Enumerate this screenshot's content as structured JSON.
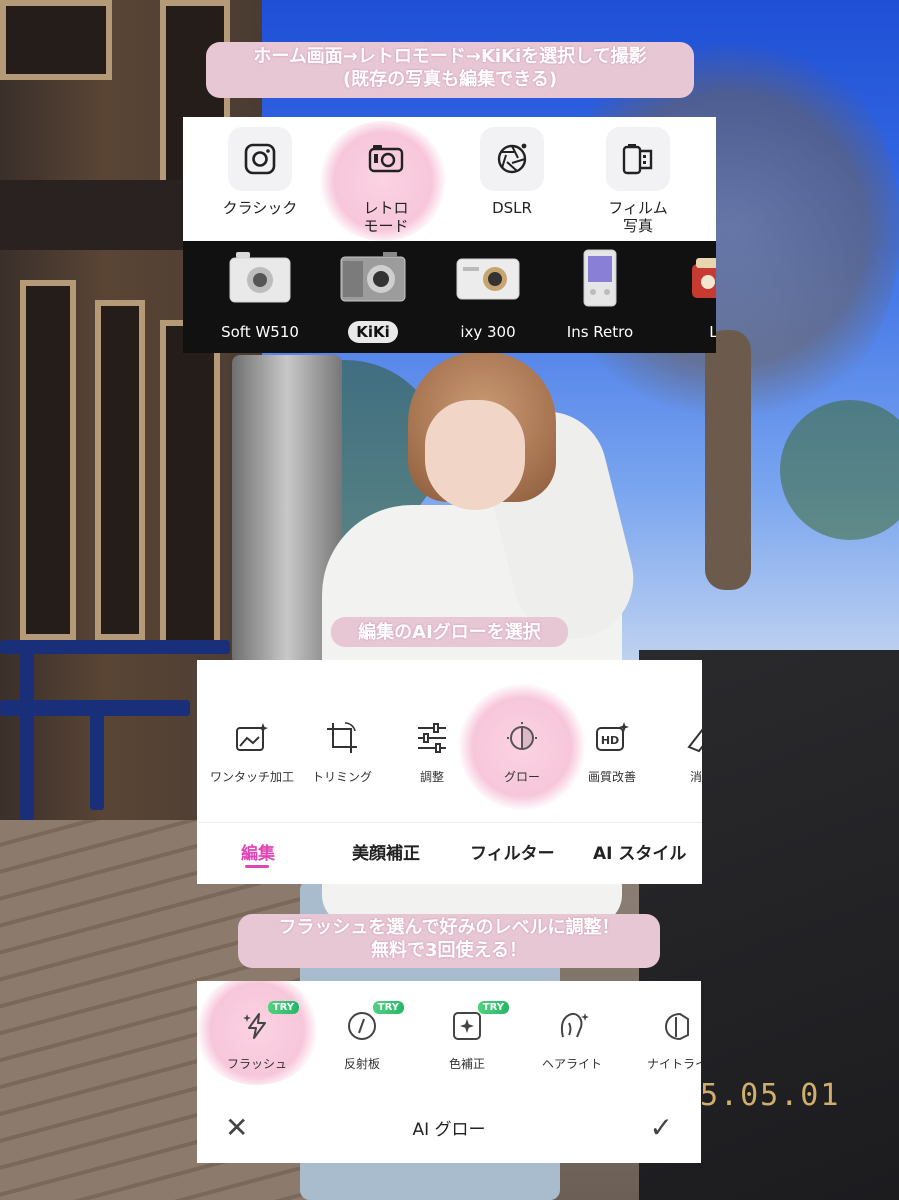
{
  "captions": {
    "top_line1": "ホーム画面→レトロモード→KiKiを選択して撮影",
    "top_line2": "(既存の写真も編集できる)",
    "middle": "編集のAIグローを選択",
    "bottom_line1": "フラッシュを選んで好みのレベルに調整！",
    "bottom_line2": "無料で3回使える！"
  },
  "mode_picker": {
    "modes": [
      {
        "label": "クラシック",
        "icon": "camera-icon"
      },
      {
        "label": "レトロ\nモード",
        "icon": "retro-camera-icon",
        "highlighted": true
      },
      {
        "label": "DSLR",
        "icon": "aperture-icon"
      },
      {
        "label": "フィルム\n写真",
        "icon": "film-icon"
      }
    ]
  },
  "camera_models": {
    "items": [
      {
        "label": "Soft W510",
        "icon": "compact-camera-silver-icon"
      },
      {
        "label": "KiKi",
        "icon": "compact-camera-gray-icon",
        "selected": true
      },
      {
        "label": "ixy 300",
        "icon": "compact-camera-white-icon"
      },
      {
        "label": "Ins Retro",
        "icon": "instant-camera-icon"
      },
      {
        "label": "Lu",
        "icon": "red-camera-icon"
      }
    ]
  },
  "edit_tools": {
    "tools": [
      {
        "label": "ワンタッチ加工",
        "icon": "magic-image-icon"
      },
      {
        "label": "トリミング",
        "icon": "crop-rotate-icon"
      },
      {
        "label": "調整",
        "icon": "sliders-icon"
      },
      {
        "label": "グロー",
        "icon": "glow-icon",
        "highlighted": true
      },
      {
        "label": "画質改善",
        "icon": "hd-icon"
      },
      {
        "label": "消し",
        "icon": "eraser-icon"
      }
    ],
    "tabs": [
      {
        "label": "編集",
        "active": true
      },
      {
        "label": "美顔補正"
      },
      {
        "label": "フィルター"
      },
      {
        "label": "AI スタイル"
      }
    ]
  },
  "ai_glow": {
    "options": [
      {
        "label": "フラッシュ",
        "icon": "flash-sparkle-icon",
        "badge": "TRY",
        "highlighted": true
      },
      {
        "label": "反射板",
        "icon": "reflector-icon",
        "badge": "TRY"
      },
      {
        "label": "色補正",
        "icon": "color-correct-icon",
        "badge": "TRY"
      },
      {
        "label": "ヘアライト",
        "icon": "hair-light-icon"
      },
      {
        "label": "ナイトライ",
        "icon": "night-light-icon"
      }
    ],
    "title": "AI グロー",
    "close_symbol": "✕",
    "confirm_symbol": "✓"
  },
  "photo": {
    "date_stamp": "5.05.01"
  },
  "colors": {
    "accent_pink": "#e045b5",
    "caption_bg": "#e8c7d4",
    "highlight_glow": "#f7c6da",
    "try_badge": "#33c070"
  }
}
